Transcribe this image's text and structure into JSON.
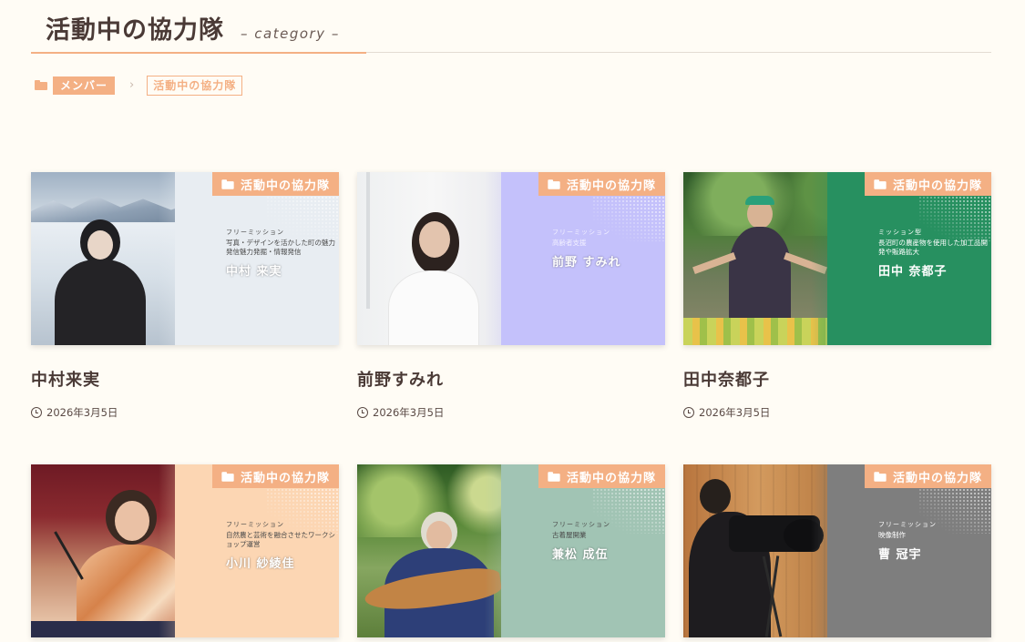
{
  "header": {
    "title": "活動中の協力隊",
    "subtitle": "– category –"
  },
  "breadcrumb": {
    "parent": "メンバー",
    "separator": "›",
    "current": "活動中の協力隊"
  },
  "colors": {
    "accent": "#f4b084",
    "background": "#fffcf5",
    "text": "#4a3a36"
  },
  "cards": [
    {
      "category": "活動中の協力隊",
      "mission_type": "フリーミッション",
      "mission_desc": "写真・デザインを活かした町の魅力発信魅力発掘・情報発信",
      "thumb_name": "中村 来実",
      "title": "中村来実",
      "date": "2026年3月5日",
      "panel_color": "#e8edf2"
    },
    {
      "category": "活動中の協力隊",
      "mission_type": "フリーミッション",
      "mission_desc": "高齢者支援",
      "thumb_name": "前野 すみれ",
      "title": "前野すみれ",
      "date": "2026年3月5日",
      "panel_color": "#c4c1fb"
    },
    {
      "category": "活動中の協力隊",
      "mission_type": "ミッション型",
      "mission_desc": "長沼町の農産物を使用した加工品開発や販路拡大",
      "thumb_name": "田中 奈都子",
      "title": "田中奈都子",
      "date": "2026年3月5日",
      "panel_color": "#279060"
    },
    {
      "category": "活動中の協力隊",
      "mission_type": "フリーミッション",
      "mission_desc": "自然農と芸術を融合させたワークショップ運営",
      "thumb_name": "小川 紗綾佳",
      "title": "",
      "date": "",
      "panel_color": "#fcd6b3"
    },
    {
      "category": "活動中の協力隊",
      "mission_type": "フリーミッション",
      "mission_desc": "古着屋開業",
      "thumb_name": "兼松 成伍",
      "title": "",
      "date": "",
      "panel_color": "#a1c4b4"
    },
    {
      "category": "活動中の協力隊",
      "mission_type": "フリーミッション",
      "mission_desc": "映像制作",
      "thumb_name": "曹 冠宇",
      "title": "",
      "date": "",
      "panel_color": "#7e7e7e"
    }
  ]
}
